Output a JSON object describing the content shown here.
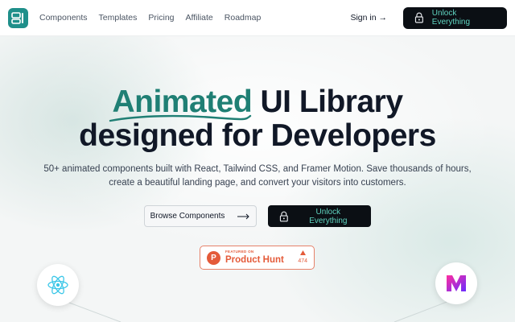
{
  "nav": {
    "links": [
      "Components",
      "Templates",
      "Pricing",
      "Affiliate",
      "Roadmap"
    ],
    "signin_label": "Sign in",
    "signin_arrow": "→",
    "unlock_label": "Unlock Everything"
  },
  "hero": {
    "headline_accent": "Animated",
    "headline_rest": " UI Library",
    "headline_line2": "designed for Developers",
    "sub_line1": "50+ animated components built with React, Tailwind CSS, and Framer Motion. Save thousands of hours,",
    "sub_line2": "create a beautiful landing page, and convert your visitors into customers.",
    "browse_label": "Browse Components",
    "unlock_label": "Unlock Everything"
  },
  "badge": {
    "featured_label": "FEATURED ON",
    "product_label": "Product Hunt",
    "letter": "P",
    "vote_count": "474"
  },
  "colors": {
    "accent": "#1f7f74",
    "button_dark": "#0b0f14",
    "button_text": "#5fd4c0",
    "product_hunt": "#e45a39"
  },
  "icons": [
    "logo-icon",
    "lock-icon",
    "arrow-right-icon",
    "product-hunt-icon",
    "upvote-icon",
    "react-icon",
    "m-logo-icon"
  ]
}
